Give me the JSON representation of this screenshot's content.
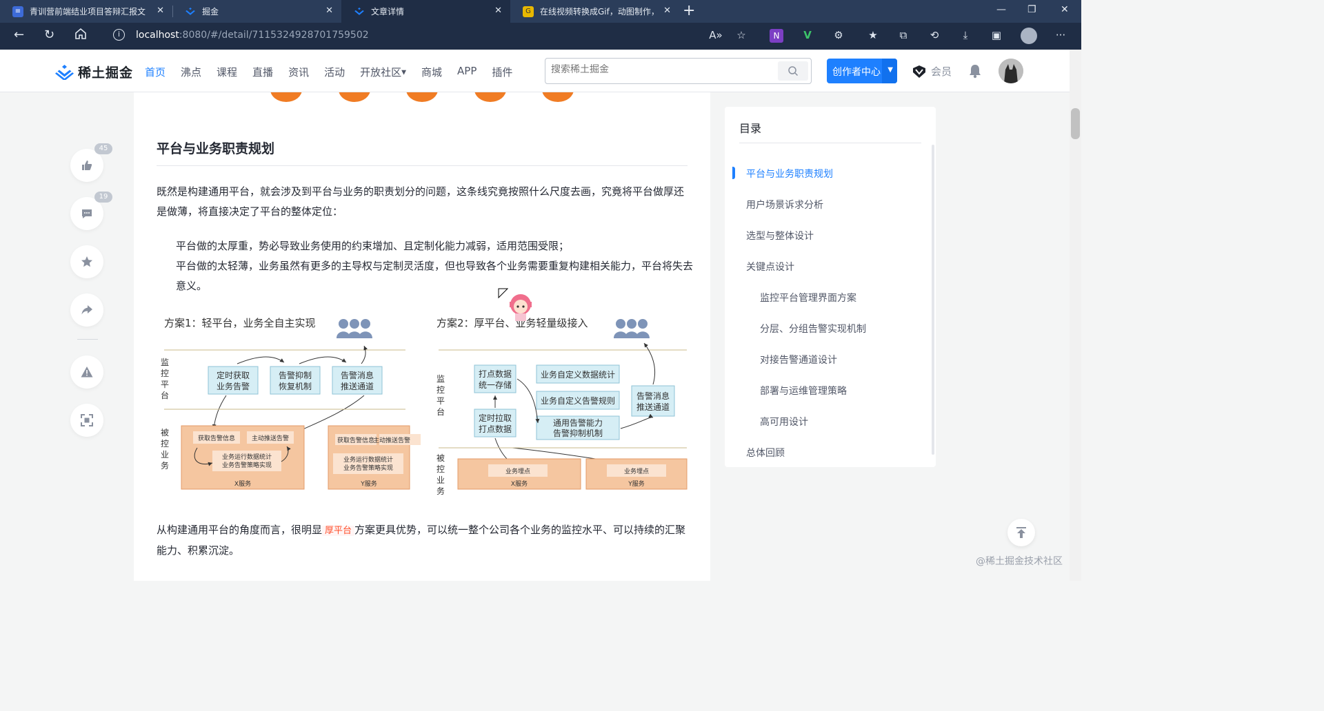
{
  "browser": {
    "tabs": [
      {
        "title": "青训营前端结业项目答辩汇报文",
        "color": "#3d6bd8",
        "glyph": "≡"
      },
      {
        "title": "掘金",
        "color": "#1e80ff",
        "glyph": "≈"
      },
      {
        "title": "文章详情",
        "color": "#1e80ff",
        "glyph": "≈"
      },
      {
        "title": "在线视频转换成Gif，动图制作，",
        "color": "#e8b800",
        "glyph": "G"
      }
    ],
    "url_host": "localhost",
    "url_path": ":8080/#/detail/7115324928701759502"
  },
  "header": {
    "logo_text": "稀土掘金",
    "nav": [
      "首页",
      "沸点",
      "课程",
      "直播",
      "资讯",
      "活动",
      "开放社区",
      "商城",
      "APP",
      "插件"
    ],
    "search_placeholder": "搜索稀土掘金",
    "creator_label": "创作者中心",
    "vip_label": "会员"
  },
  "actions": {
    "like_count": "45",
    "comment_count": "19"
  },
  "article": {
    "heading": "平台与业务职责规划",
    "para1": "既然是构建通用平台，就会涉及到平台与业务的职责划分的问题，这条线究竟按照什么尺度去画，究竟将平台做厚还是做薄，将直接决定了平台的整体定位：",
    "quote1": "平台做的太厚重，势必导致业务使用的约束增加、且定制化能力减弱，适用范围受限；",
    "quote2": "平台做的太轻薄，业务虽然有更多的主导权与定制灵活度，但也导致各个业务需要重复构建相关能力，平台将失去意义。",
    "para2_pre": "从构建通用平台的角度而言，很明显",
    "para2_code": "厚平台",
    "para2_post": "方案更具优势，可以统一整个公司各个业务的监控水平、可以持续的汇聚能力、积累沉淀。",
    "diagram": {
      "left_title": "方案1：轻平台，业务全自主实现",
      "right_title": "方案2：厚平台、业务轻量级接入",
      "monitor_label": [
        "监",
        "控",
        "平",
        "台"
      ],
      "monitored_label": [
        "被",
        "控",
        "业",
        "务"
      ],
      "left_boxes": [
        [
          "定时获取",
          "业务告警"
        ],
        [
          "告警抑制",
          "恢复机制"
        ],
        [
          "告警消息",
          "推送通道"
        ]
      ],
      "left_service_items": [
        "获取告警信息",
        "主动推送告警",
        "业务运行数据统计",
        "业务告警策略实现"
      ],
      "x_service": "X服务",
      "y_service": "Y服务",
      "right_boxes": [
        [
          "打点数据",
          "统一存储"
        ],
        [
          "定时拉取",
          "打点数据"
        ],
        [
          "业务自定义数据统计"
        ],
        [
          "业务自定义告警规则"
        ],
        [
          "通用告警能力",
          "告警抑制机制"
        ],
        [
          "告警消息",
          "推送通道"
        ]
      ],
      "point_label": "业务埋点"
    }
  },
  "toc": {
    "title": "目录",
    "items": [
      {
        "label": "平台与业务职责规划",
        "level": 1
      },
      {
        "label": "用户场景诉求分析",
        "level": 1
      },
      {
        "label": "选型与整体设计",
        "level": 1
      },
      {
        "label": "关键点设计",
        "level": 1
      },
      {
        "label": "监控平台管理界面方案",
        "level": 2
      },
      {
        "label": "分层、分组告警实现机制",
        "level": 2
      },
      {
        "label": "对接告警通道设计",
        "level": 2
      },
      {
        "label": "部署与运维管理策略",
        "level": 2
      },
      {
        "label": "高可用设计",
        "level": 2
      },
      {
        "label": "总体回顾",
        "level": 1
      }
    ]
  },
  "watermark": "@稀土掘金技术社区"
}
